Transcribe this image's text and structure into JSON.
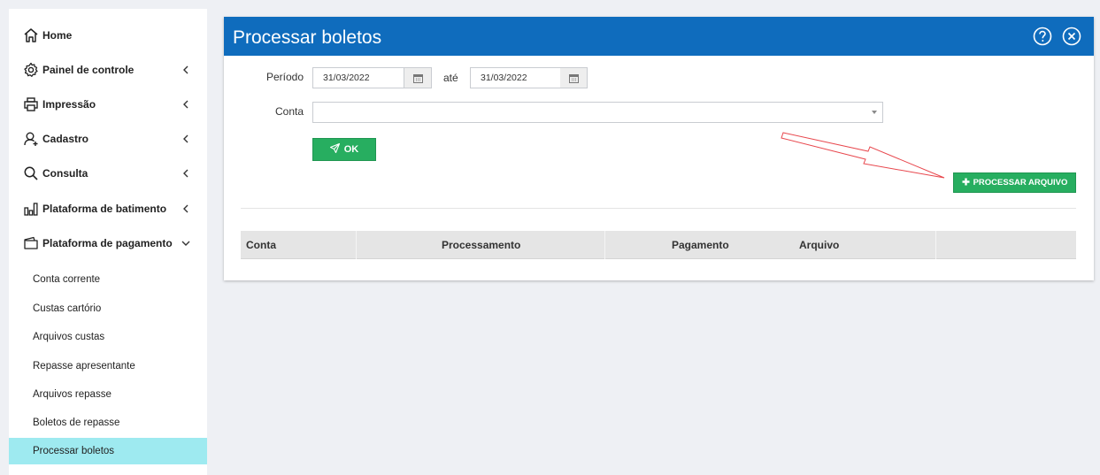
{
  "sidebar": {
    "items": [
      {
        "label": "Home",
        "icon": "home-icon"
      },
      {
        "label": "Painel de controle",
        "icon": "gear-icon"
      },
      {
        "label": "Impressão",
        "icon": "printer-icon"
      },
      {
        "label": "Cadastro",
        "icon": "user-add-icon"
      },
      {
        "label": "Consulta",
        "icon": "search-icon"
      },
      {
        "label": "Plataforma de batimento",
        "icon": "bar-chart-icon"
      },
      {
        "label": "Plataforma de pagamento",
        "icon": "wallet-icon"
      }
    ],
    "sub_items": [
      {
        "label": "Conta corrente"
      },
      {
        "label": "Custas cartório"
      },
      {
        "label": "Arquivos custas"
      },
      {
        "label": "Repasse apresentante"
      },
      {
        "label": "Arquivos repasse"
      },
      {
        "label": "Boletos de repasse"
      },
      {
        "label": "Processar boletos"
      }
    ],
    "active_color": "#9eeaf0"
  },
  "panel": {
    "title": "Processar boletos",
    "header_color": "#0f6cbd",
    "periodo_label": "Período",
    "date_from": "31/03/2022",
    "ate_label": "até",
    "date_to": "31/03/2022",
    "conta_label": "Conta",
    "conta_value": "",
    "ok_label": "OK",
    "processar_label": "PROCESSAR ARQUIVO",
    "button_color": "#27ae60"
  },
  "table": {
    "columns": [
      "Conta",
      "Processamento",
      "Pagamento",
      "Arquivo"
    ]
  },
  "annotation": {
    "arrow_color": "#e8474d"
  }
}
